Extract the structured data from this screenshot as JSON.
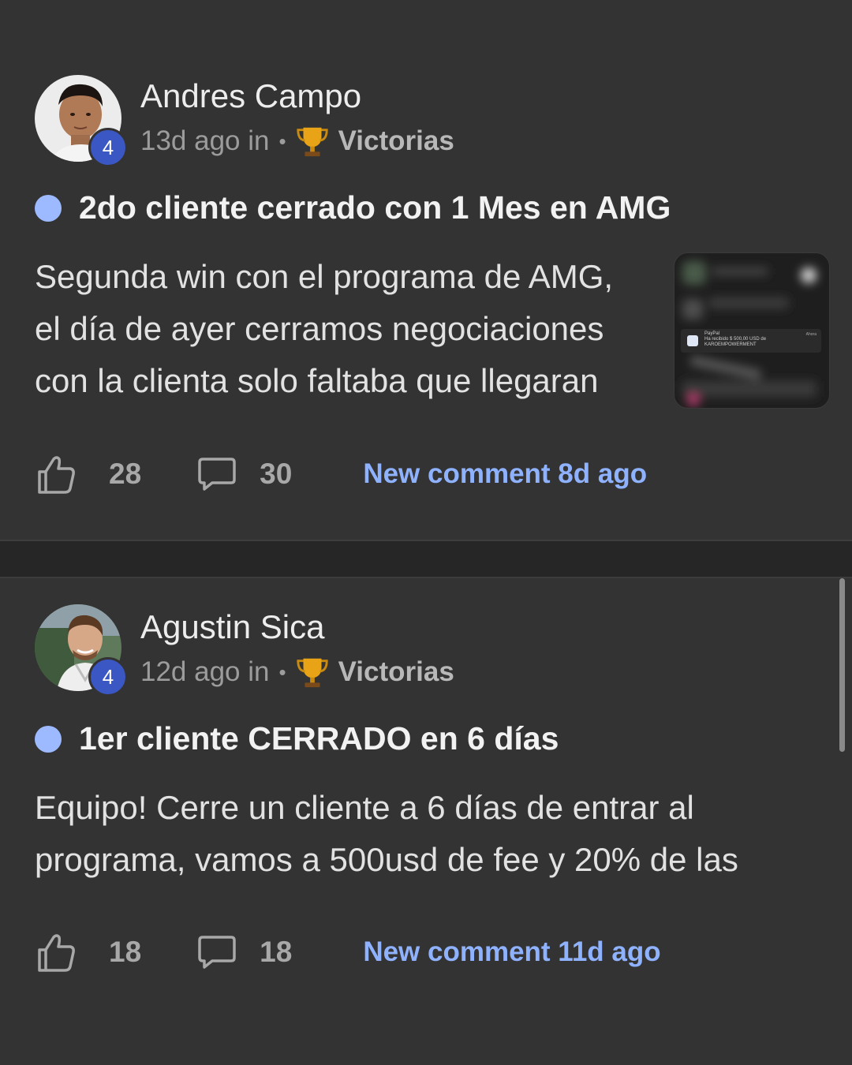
{
  "posts": [
    {
      "author": "Andres Campo",
      "level": "4",
      "time_in": "13d ago in",
      "separator": "•",
      "category_icon": "trophy-icon",
      "category": "Victorias",
      "title": "2do cliente cerrado con 1 Mes en AMG",
      "excerpt_lines": [
        "Segunda win con el programa de AMG,",
        "el día de ayer cerramos negociaciones",
        "con la clienta solo faltaba que llegaran"
      ],
      "thumbnail": {
        "app": "PayPal",
        "text": "Ha recibido $ 500,00 USD de",
        "text2": "KAROEMPOWERMENT",
        "time": "Ahora"
      },
      "likes": "28",
      "comments": "30",
      "new_comment": "New comment 8d ago"
    },
    {
      "author": "Agustin Sica",
      "level": "4",
      "time_in": "12d ago in",
      "separator": "•",
      "category_icon": "trophy-icon",
      "category": "Victorias",
      "title": "1er cliente CERRADO en 6 días",
      "excerpt_lines": [
        "Equipo! Cerre un cliente a 6 días de entrar al",
        "programa, vamos a 500usd de fee y 20% de las"
      ],
      "likes": "18",
      "comments": "18",
      "new_comment": "New comment 11d ago"
    }
  ],
  "colors": {
    "background": "#333333",
    "unread_dot": "#9db9ff",
    "link": "#8fb2ff",
    "level_badge": "#3b57c4"
  }
}
